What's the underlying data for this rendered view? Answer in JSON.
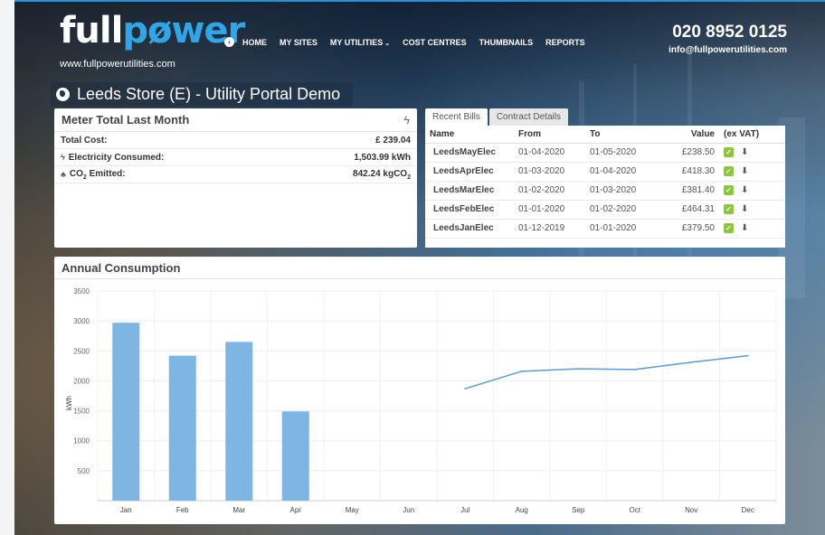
{
  "header": {
    "logo_part1": "full",
    "logo_part2": "p",
    "logo_part3": "wer",
    "website": "www.fullpowerutilities.com",
    "phone": "020 8952 0125",
    "email": "info@fullpowerutilities.com",
    "nav": [
      "HOME",
      "MY SITES",
      "MY UTILITIES",
      "COST CENTRES",
      "THUMBNAILS",
      "REPORTS"
    ]
  },
  "page_title": "Leeds Store (E) - Utility Portal Demo",
  "meter": {
    "title": "Meter Total Last Month",
    "rows": [
      {
        "label": "Total Cost:",
        "value": "£ 239.04"
      },
      {
        "label": "Electricity Consumed:",
        "value": "1,503.99 kWh"
      },
      {
        "label": "CO",
        "label_sub": "2",
        "label_rest": " Emitted:",
        "value": "842.24 kgCO",
        "value_sub": "2"
      }
    ]
  },
  "bills": {
    "tabs": [
      "Recent Bills",
      "Contract Details"
    ],
    "columns": [
      "Name",
      "From",
      "To",
      "Value",
      "(ex VAT)"
    ],
    "rows": [
      {
        "name": "LeedsMayElec",
        "from": "01-04-2020",
        "to": "01-05-2020",
        "value": "£238.50"
      },
      {
        "name": "LeedsAprElec",
        "from": "01-03-2020",
        "to": "01-04-2020",
        "value": "£418.30"
      },
      {
        "name": "LeedsMarElec",
        "from": "01-02-2020",
        "to": "01-03-2020",
        "value": "£381.40"
      },
      {
        "name": "LeedsFebElec",
        "from": "01-01-2020",
        "to": "01-02-2020",
        "value": "£464.31"
      },
      {
        "name": "LeedsJanElec",
        "from": "01-12-2019",
        "to": "01-01-2020",
        "value": "£379.50"
      }
    ]
  },
  "annual": {
    "title": "Annual Consumption"
  },
  "chart_data": {
    "type": "bar",
    "ylabel": "kWh",
    "ylim": [
      0,
      3500
    ],
    "yticks": [
      500,
      1000,
      1500,
      2000,
      2500,
      3000,
      3500
    ],
    "categories": [
      "Jan",
      "Feb",
      "Mar",
      "Apr",
      "May",
      "Jun",
      "Jul",
      "Aug",
      "Sep",
      "Oct",
      "Nov",
      "Dec"
    ],
    "series": [
      {
        "type": "bar",
        "values": [
          2970,
          2420,
          2650,
          1490,
          null,
          null,
          null,
          null,
          null,
          null,
          null,
          null
        ],
        "color": "#7eb6e3"
      },
      {
        "type": "line",
        "values": [
          null,
          null,
          null,
          null,
          null,
          null,
          1870,
          2160,
          2200,
          2190,
          2310,
          2420
        ],
        "color": "#5a9bd5"
      }
    ],
    "grid": true
  },
  "colors": {
    "accent": "#2fa6e8",
    "check": "#8cc63f",
    "bar": "#7eb6e3",
    "line": "#5a9bd5"
  }
}
